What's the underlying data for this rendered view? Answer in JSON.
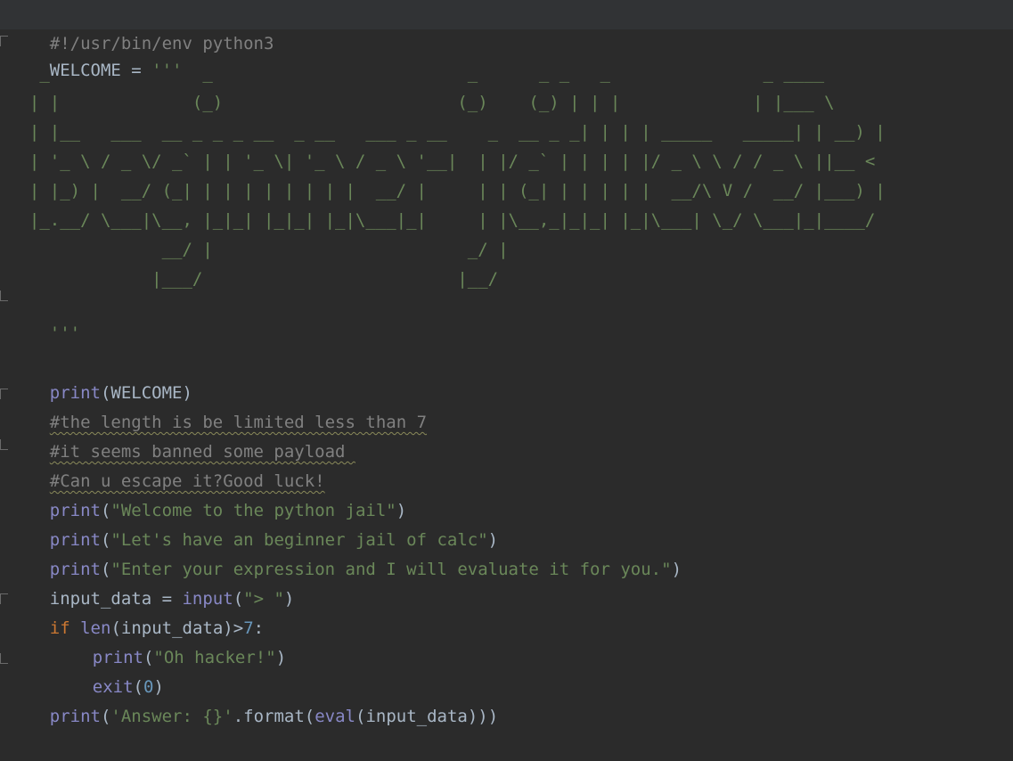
{
  "editor": {
    "shebang": "#!/usr/bin/env python3",
    "welcome_var": "WELCOME",
    "assign_op": " = ",
    "triple_quote_open": "'''",
    "ascii_art": "   _               _                         _      _ _   _               _ ____\n  | |             (_)                       (_)    (_) | | |             | |___ \\\n  | |__   ___  __ _ _ _ __  _ __   ___ _ __    _  __ _ _| | | | _____   _____| | __) |\n  | '_ \\ / _ \\/ _` | | '_ \\| '_ \\ / _ \\ '__|  | |/ _` | | | | |/ _ \\ \\ / / _ \\ ||__ <\n  | |_) |  __/ (_| | | | | | | | |  __/ |     | | (_| | | | | |  __/\\ V /  __/ |___) |\n  |_.__/ \\___|\\__, |_|_| |_|_| |_|\\___|_|     | |\\__,_|_|_| |_|\\___| \\_/ \\___|_|____/\n               __/ |                         _/ |\n              |___/                         |__/",
    "triple_quote_close": "'''",
    "print_kw": "print",
    "open_paren": "(",
    "close_paren": ")",
    "welcome_arg": "WELCOME",
    "comment1": "#the length is be limited less than 7",
    "comment2": "#it seems banned some payload ",
    "comment3": "#Can u escape it?Good luck!",
    "str1": "\"Welcome to the python jail\"",
    "str2": "\"Let's have an beginner jail of calc\"",
    "str3": "\"Enter your expression and I will evaluate it for you.\"",
    "input_var": "input_data",
    "input_fn": "input",
    "input_prompt": "\"> \"",
    "if_kw": "if",
    "len_fn": "len",
    "len_arg": "input_data",
    "gt_op": ">",
    "limit_num": "7",
    "colon": ":",
    "hacker_str": "\"Oh hacker!\"",
    "exit_fn": "exit",
    "exit_code": "0",
    "answer_str": "'Answer: {}'",
    "format_call": ".format(",
    "eval_fn": "eval",
    "eval_arg": "input_data",
    "tail_parens": ")))"
  },
  "colors": {
    "background": "#2b2b2b",
    "string": "#6a8759",
    "builtin": "#8888c6",
    "keyword": "#cc7832",
    "number": "#6897bb",
    "comment": "#808080",
    "text": "#a9b7c6"
  }
}
